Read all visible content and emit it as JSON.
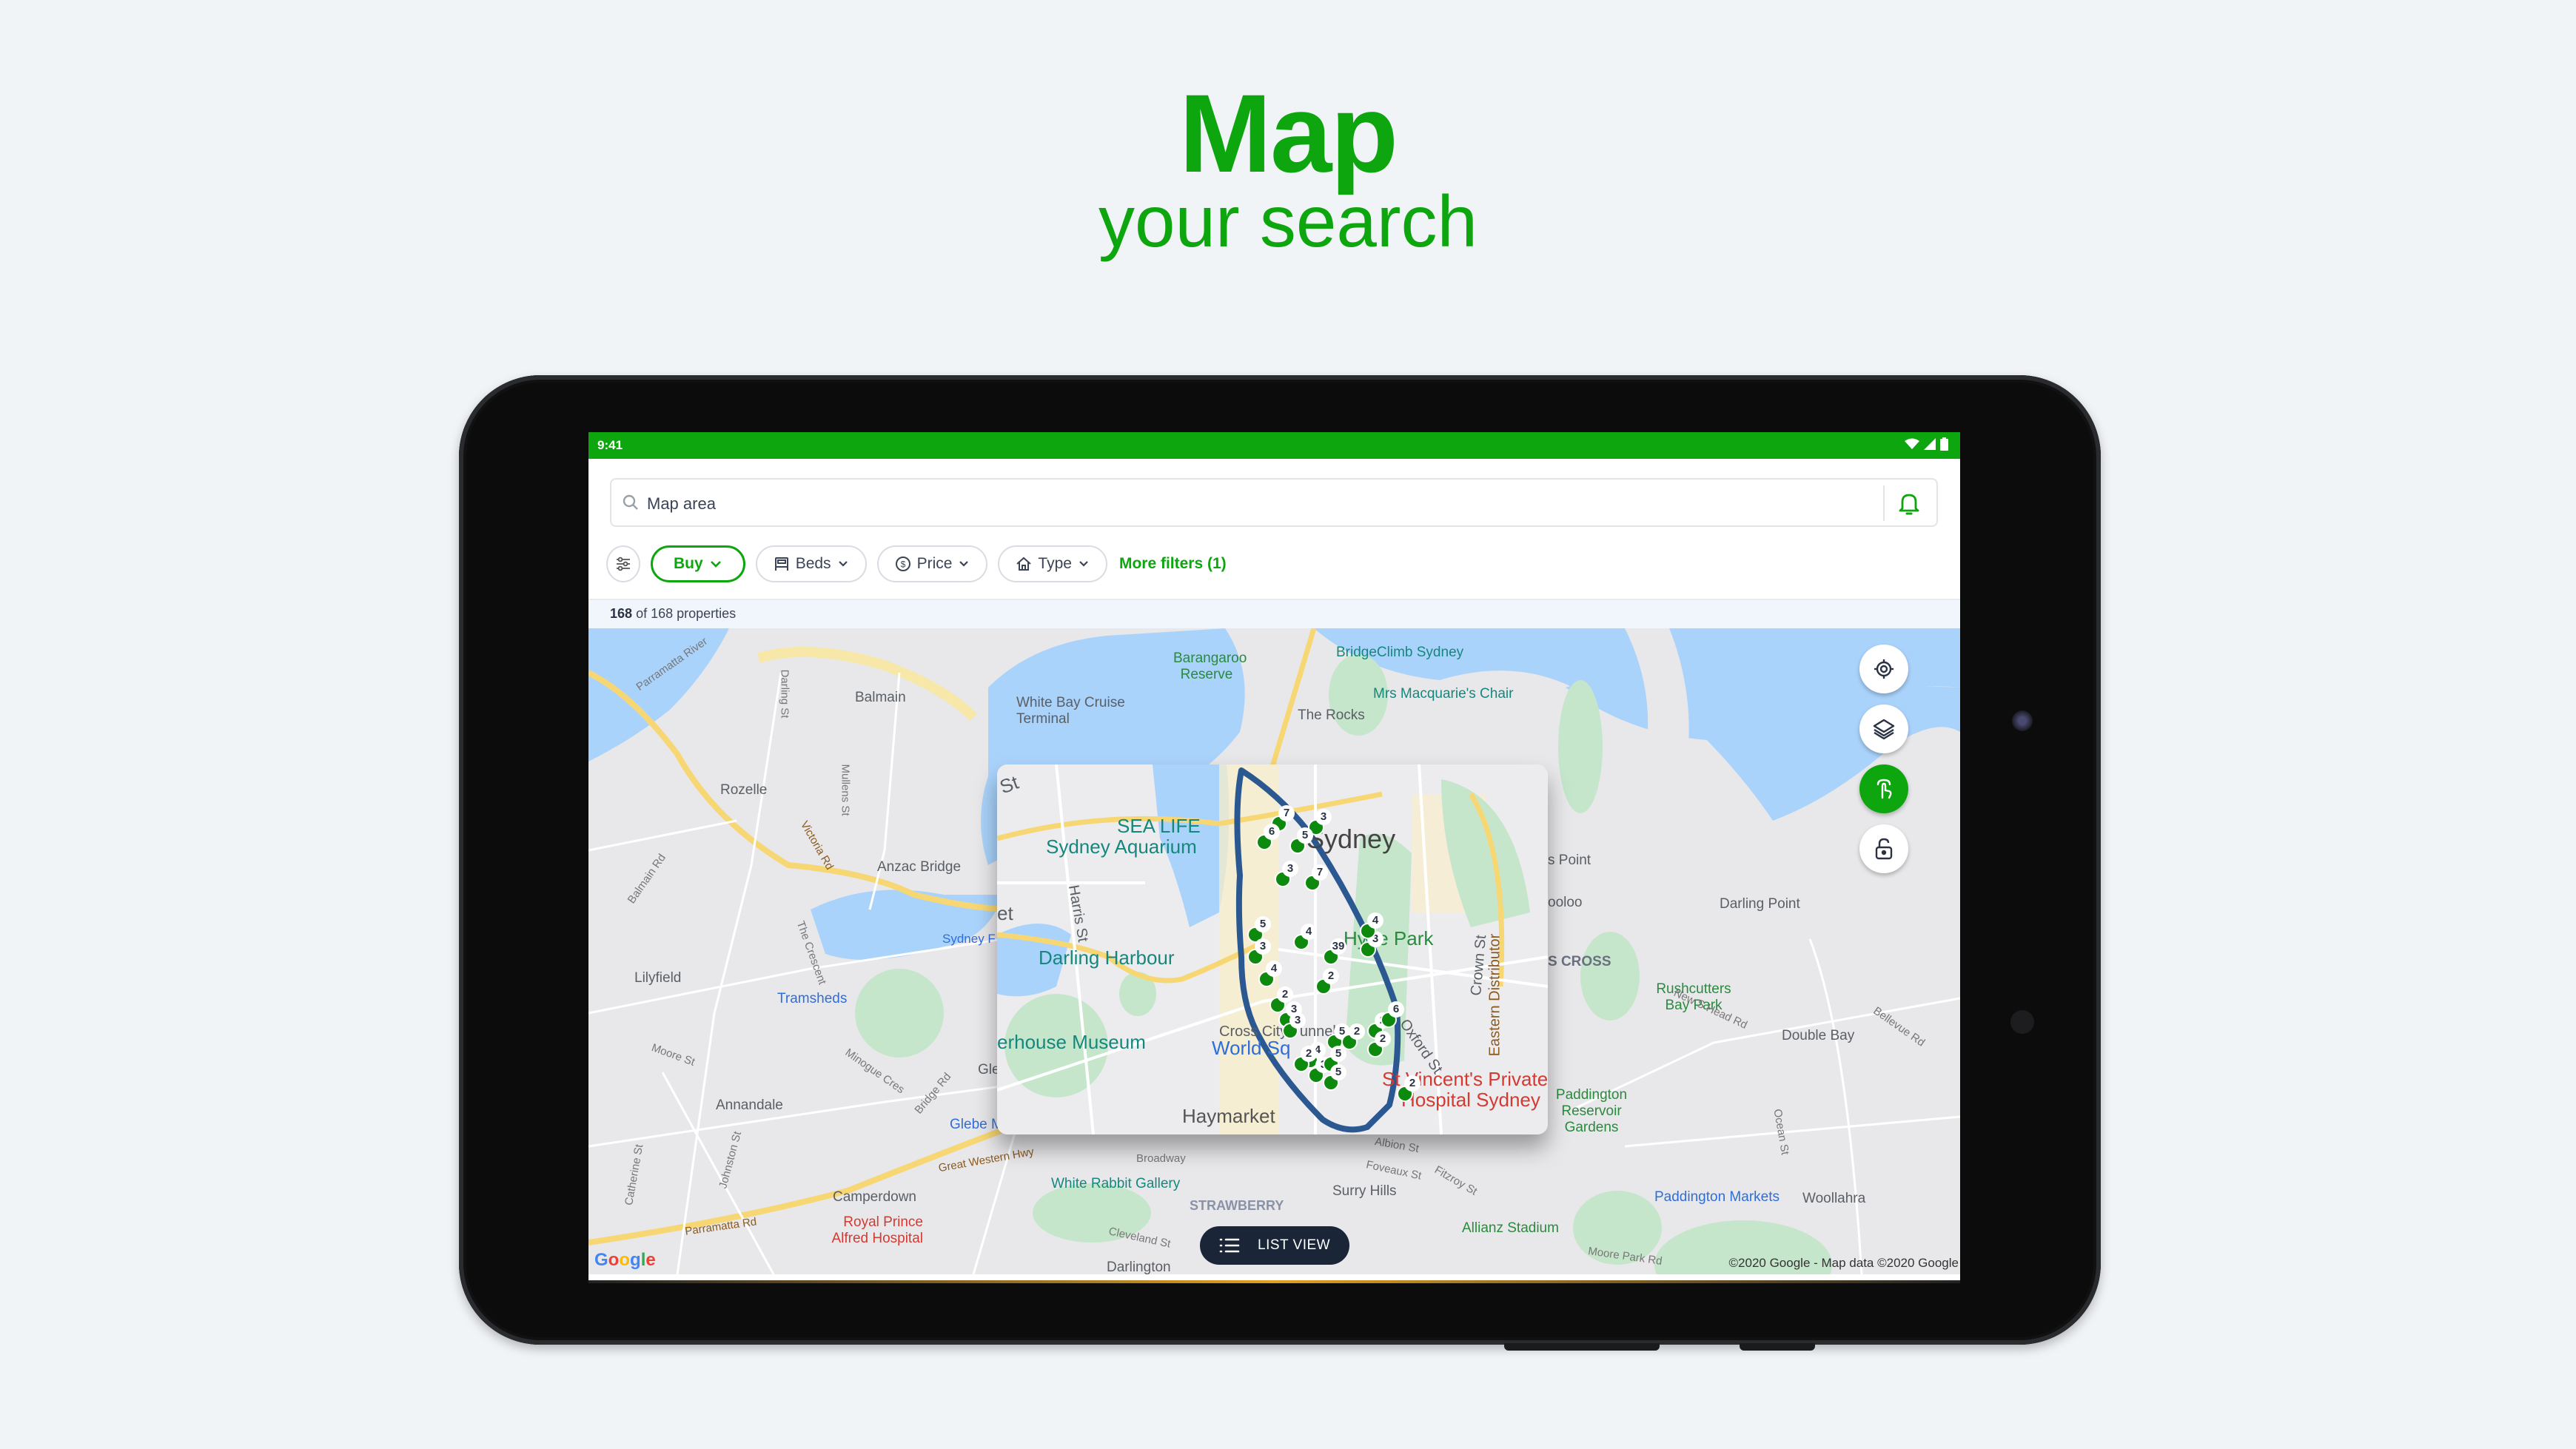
{
  "promo": {
    "title": "Map",
    "subtitle": "your search"
  },
  "colors": {
    "brand_green": "#0ea60e",
    "pill_navy": "#1a2538",
    "draw_outline": "#2b5891"
  },
  "statusbar": {
    "time": "9:41",
    "icons": [
      "wifi-icon",
      "signal-icon",
      "battery-icon"
    ]
  },
  "search": {
    "placeholder": "Map area",
    "search_icon": "search-icon",
    "alert_icon": "bell-icon"
  },
  "filters": {
    "settings_icon": "sliders-icon",
    "chips": [
      {
        "label": "Buy",
        "icon": "",
        "active": true
      },
      {
        "label": "Beds",
        "icon": "bed-icon",
        "active": false
      },
      {
        "label": "Price",
        "icon": "dollar-circle-icon",
        "active": false
      },
      {
        "label": "Type",
        "icon": "house-icon",
        "active": false
      }
    ],
    "more_filters": "More filters (1)"
  },
  "results": {
    "shown": "168",
    "rest": "of 168 properties"
  },
  "map": {
    "labels": {
      "balmain": "Balmain",
      "rozelle": "Rozelle",
      "lilyfield": "Lilyfield",
      "annandale": "Annandale",
      "camperdown": "Camperdown",
      "darlington": "Darlington",
      "surry_hills": "Surry Hills",
      "darling_point": "Darling Point",
      "double_bay": "Double Bay",
      "woollahra": "Woollahra",
      "the_rocks": "The Rocks",
      "barangaroo": "Barangaroo Reserve",
      "white_bay": "White Bay Cruise Terminal",
      "anzac": "Anzac Bridge",
      "tramsheds": "Tramsheds",
      "bridgeclimb": "BridgeClimb Sydney",
      "macquarie": "Mrs Macquarie's Chair",
      "rushcutters": "Rushcutters Bay Park",
      "paddington_res": "Paddington Reservoir Gardens",
      "paddington_mkts": "Paddington Markets",
      "allianz": "Allianz Stadium",
      "white_rabbit": "White Rabbit Gallery",
      "rpa": "Royal Prince Alfred Hospital",
      "glebe": "Glebe M",
      "kings_cross": "S CROSS",
      "strawberry": "STRAWBERRY",
      "sydney_f": "Sydney F",
      "potts_point": "s Point",
      "wooloo": "ooloo",
      "gle": "Gle",
      "streets": {
        "darling_st": "Darling St",
        "mullens_st": "Mullens St",
        "victoria_rd": "Victoria Rd",
        "balmain_rd": "Balmain Rd",
        "crescent": "The Crescent",
        "moore_st": "Moore St",
        "minogue": "Minogue Cres",
        "bridge_rd": "Bridge Rd",
        "gwh": "Great Western Hwy",
        "parramatta": "Parramatta Rd",
        "catherine": "Catherine St",
        "johnston": "Johnston St",
        "broadway": "Broadway",
        "cleveland": "Cleveland St",
        "albion": "Albion St",
        "foveaux": "Foveaux St",
        "fitzroy": "Fitzroy St",
        "new_s_head": "New S Head Rd",
        "bellevue": "Bellevue Rd",
        "ocean": "Ocean St",
        "moore_park": "Moore Park Rd",
        "parramatta_river": "Parramatta River"
      }
    },
    "inset": {
      "sydney": "Sydney",
      "sea_life": "SEA LIFE",
      "aquarium": "Sydney Aquarium",
      "darling_harbour": "Darling Harbour",
      "powerhouse": "erhouse Museum",
      "world_sq": "World Sq",
      "hyde_park": "Hyde Park",
      "haymarket": "Haymarket",
      "st_vincents": "St Vincent's Private",
      "hospital": "Hospital Sydney",
      "harris_st": "Harris St",
      "crown_st": "Crown St",
      "eastern": "Eastern Distributor",
      "oxford": "Oxford St",
      "cross_city": "Cross City Tunnel",
      "st": "St",
      "et": "et",
      "markers": [
        {
          "count": "7"
        },
        {
          "count": "3"
        },
        {
          "count": "6"
        },
        {
          "count": "5"
        },
        {
          "count": "7"
        },
        {
          "count": "3"
        },
        {
          "count": "5"
        },
        {
          "count": "3"
        },
        {
          "count": "4"
        },
        {
          "count": "39"
        },
        {
          "count": "3"
        },
        {
          "count": "4"
        },
        {
          "count": "2"
        },
        {
          "count": "4"
        },
        {
          "count": "2"
        },
        {
          "count": "3"
        },
        {
          "count": "3"
        },
        {
          "count": "5"
        },
        {
          "count": "2"
        },
        {
          "count": "2"
        },
        {
          "count": "6"
        },
        {
          "count": "2"
        },
        {
          "count": "4"
        },
        {
          "count": "2"
        },
        {
          "count": "3"
        },
        {
          "count": "5"
        },
        {
          "count": "5"
        },
        {
          "count": "2"
        }
      ]
    },
    "controls": [
      {
        "name": "locate-button",
        "icon": "crosshair-icon"
      },
      {
        "name": "layers-button",
        "icon": "layers-icon"
      },
      {
        "name": "draw-button",
        "icon": "draw-hand-icon"
      },
      {
        "name": "lock-button",
        "icon": "unlock-icon"
      }
    ],
    "list_view": "LIST VIEW",
    "google": "Google",
    "copyright": "©2020 Google - Map data ©2020 Google"
  }
}
